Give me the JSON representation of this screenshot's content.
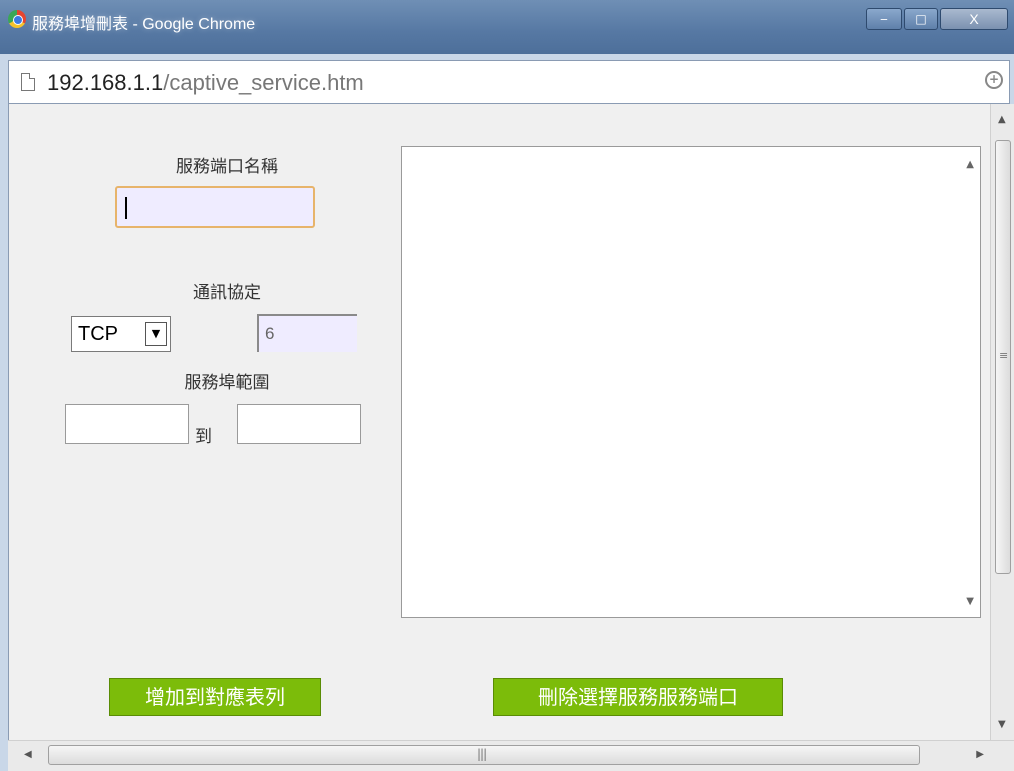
{
  "window": {
    "title": "服務埠增刪表 - Google Chrome",
    "controls": {
      "minimize": "‒",
      "maximize": "□",
      "close": "X"
    }
  },
  "addressbar": {
    "host": "192.168.1.1",
    "path": "/captive_service.htm"
  },
  "form": {
    "service_name_label": "服務端口名稱",
    "service_name_value": "",
    "protocol_label": "通訊協定",
    "protocol_selected": "TCP",
    "protocol_number": "6",
    "port_range_label": "服務埠範圍",
    "port_range_to": "到",
    "port_from_value": "",
    "port_to_value": ""
  },
  "buttons": {
    "add_label": "增加到對應表列",
    "delete_label": "刪除選擇服務服務端口"
  },
  "colors": {
    "accent_green": "#7cbc0a",
    "input_highlight": "#efecff",
    "focus_border": "#e7b46b"
  }
}
